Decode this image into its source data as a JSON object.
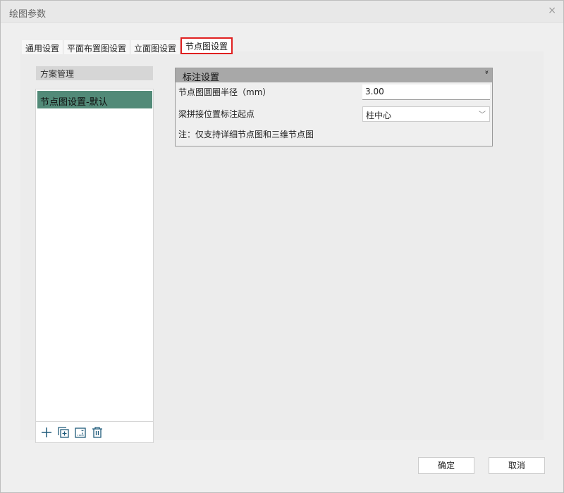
{
  "window": {
    "title": "绘图参数",
    "close": "×"
  },
  "tabs": [
    "通用设置",
    "平面布置图设置",
    "立面图设置",
    "节点图设置"
  ],
  "scheme": {
    "header": "方案管理",
    "items": [
      "节点图设置-默认"
    ]
  },
  "panel": {
    "title": "标注设置",
    "collapse": "»",
    "radius_label": "节点图圆圈半径（mm）",
    "radius_value": "3.00",
    "splice_label": "梁拼接位置标注起点",
    "splice_value": "柱中心",
    "note": "注：仅支持详细节点图和三维节点图"
  },
  "buttons": {
    "ok": "确定",
    "cancel": "取消"
  },
  "colors": {
    "accent": "#528a78",
    "active_tab_border": "#e02020",
    "icon": "#1f5a7a"
  }
}
